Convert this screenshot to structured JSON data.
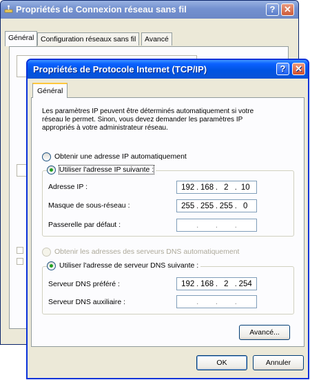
{
  "back_window": {
    "title": "Propriétés de Connexion réseau sans fil",
    "help_glyph": "?",
    "close_glyph": "✕",
    "tabs": [
      "Général",
      "Configuration réseaux sans fil",
      "Avancé"
    ]
  },
  "front_window": {
    "title": "Propriétés de Protocole Internet (TCP/IP)",
    "help_glyph": "?",
    "close_glyph": "✕",
    "tab": "Général",
    "description": "Les paramètres IP peuvent être déterminés automatiquement si votre réseau le permet. Sinon, vous devez demander les paramètres IP appropriés à votre administrateur réseau.",
    "ip_auto_label": "Obtenir une adresse IP automatiquement",
    "ip_manual_label": "Utiliser l'adresse IP suivante :",
    "ip_fields": [
      {
        "label": "Adresse IP :",
        "octets": [
          "192",
          "168",
          "2",
          "10"
        ]
      },
      {
        "label": "Masque de sous-réseau :",
        "octets": [
          "255",
          "255",
          "255",
          "0"
        ]
      },
      {
        "label": "Passerelle par défaut :",
        "octets": [
          "",
          "",
          "",
          ""
        ]
      }
    ],
    "dns_auto_label": "Obtenir les adresses des serveurs DNS automatiquement",
    "dns_manual_label": "Utiliser l'adresse de serveur DNS suivante :",
    "dns_fields": [
      {
        "label": "Serveur DNS préféré :",
        "octets": [
          "192",
          "168",
          "2",
          "254"
        ]
      },
      {
        "label": "Serveur DNS auxiliaire :",
        "octets": [
          "",
          "",
          "",
          ""
        ]
      }
    ],
    "advanced_button": "Avancé...",
    "ok_button": "OK",
    "cancel_button": "Annuler"
  },
  "colors": {
    "titlebar_blue": "#0054e3",
    "window_face": "#ece9d8",
    "radio_dot": "#21a121",
    "close_red": "#d14f2b"
  },
  "icons": {
    "back_window": "network-connection-icon"
  }
}
